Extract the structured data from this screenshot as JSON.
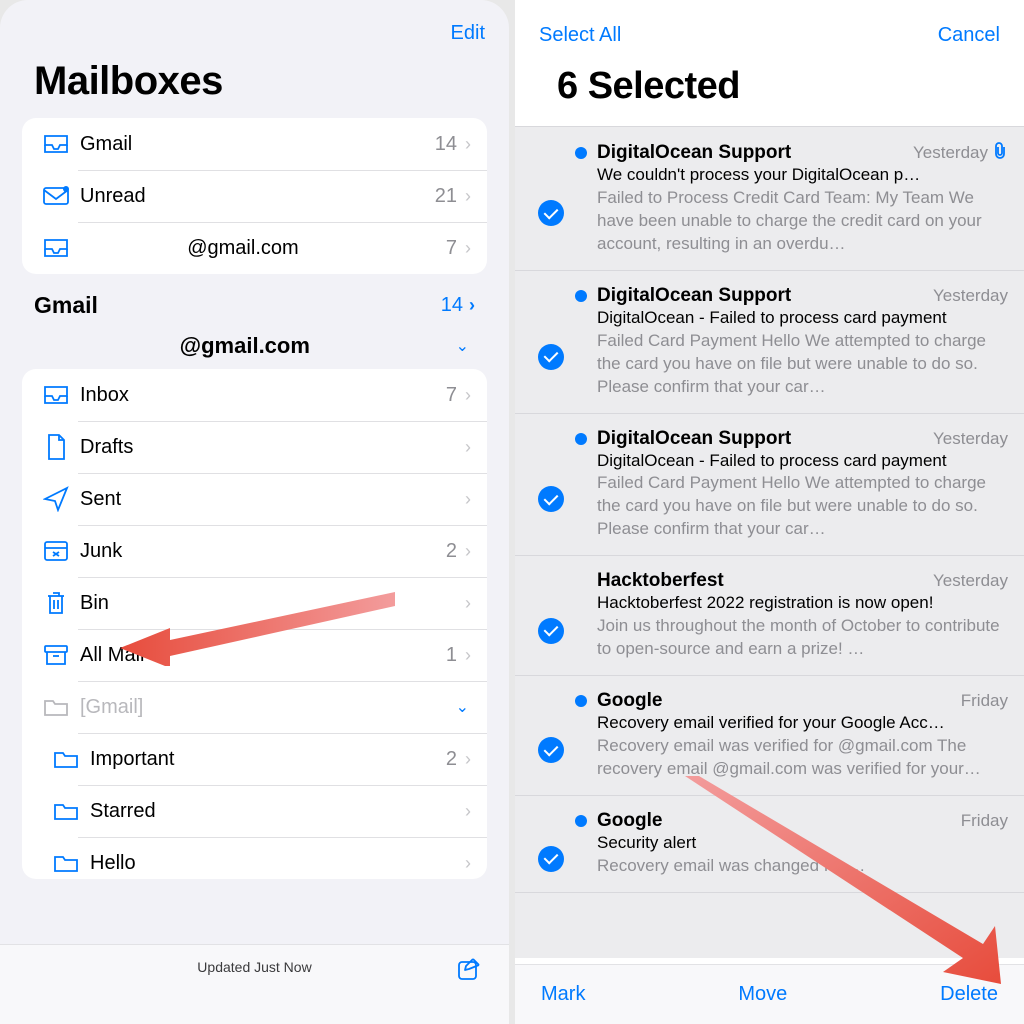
{
  "left": {
    "edit": "Edit",
    "title": "Mailboxes",
    "top_mailboxes": [
      {
        "icon": "inbox",
        "label": "Gmail",
        "count": "14",
        "disclosure": "chev"
      },
      {
        "icon": "unread",
        "label": "Unread",
        "count": "21",
        "disclosure": "chev"
      },
      {
        "icon": "inbox",
        "label": "@gmail.com",
        "count": "7",
        "disclosure": "chev",
        "center": true
      }
    ],
    "section": {
      "label": "Gmail",
      "count": "14"
    },
    "account_header": "@gmail.com",
    "folders": [
      {
        "icon": "inbox",
        "label": "Inbox",
        "count": "7",
        "disclosure": "chev"
      },
      {
        "icon": "drafts",
        "label": "Drafts",
        "count": "",
        "disclosure": "chev"
      },
      {
        "icon": "sent",
        "label": "Sent",
        "count": "",
        "disclosure": "chev"
      },
      {
        "icon": "junk",
        "label": "Junk",
        "count": "2",
        "disclosure": "chev"
      },
      {
        "icon": "bin",
        "label": "Bin",
        "count": "",
        "disclosure": "chev"
      },
      {
        "icon": "archive",
        "label": "All Mail",
        "count": "1",
        "disclosure": "chev"
      },
      {
        "icon": "folder",
        "label": "[Gmail]",
        "count": "",
        "disclosure": "caret",
        "disabled": true
      },
      {
        "icon": "folder",
        "label": "Important",
        "count": "2",
        "disclosure": "chev",
        "sub": true
      },
      {
        "icon": "folder",
        "label": "Starred",
        "count": "",
        "disclosure": "chev",
        "sub": true
      },
      {
        "icon": "folder",
        "label": "Hello",
        "count": "",
        "disclosure": "chev",
        "sub": true
      }
    ],
    "status": "Updated Just Now"
  },
  "right": {
    "select_all": "Select All",
    "cancel": "Cancel",
    "title": "6 Selected",
    "messages": [
      {
        "unread": true,
        "sender": "DigitalOcean Support",
        "when": "Yesterday",
        "attach": true,
        "subject": "We couldn't process your DigitalOcean p…",
        "preview": "Failed to Process Credit Card Team: My Team We have been unable to charge the credit card on your account, resulting in an overdu…"
      },
      {
        "unread": true,
        "sender": "DigitalOcean Support",
        "when": "Yesterday",
        "subject": "DigitalOcean - Failed to process card payment",
        "preview": "Failed Card Payment Hello We attempted to charge the card you have on file but were unable to do so. Please confirm that your car…"
      },
      {
        "unread": true,
        "sender": "DigitalOcean Support",
        "when": "Yesterday",
        "subject": "DigitalOcean - Failed to process card payment",
        "preview": "Failed Card Payment Hello We attempted to charge the card you have on file but were unable to do so. Please confirm that your car…"
      },
      {
        "unread": false,
        "sender": "Hacktoberfest",
        "when": "Yesterday",
        "subject": "Hacktoberfest 2022 registration is now open!",
        "preview": "Join us throughout the month of October to contribute to open-source and earn a prize!\n…"
      },
      {
        "unread": true,
        "sender": "Google",
        "when": "Friday",
        "subject": "Recovery email verified for your Google Acc…",
        "preview": "Recovery email was verified for             @gmail.com The recovery email             @gmail.com was verified for your…"
      },
      {
        "unread": true,
        "sender": "Google",
        "when": "Friday",
        "subject": "Security alert",
        "preview": "Recovery email was changed for …"
      }
    ],
    "footer": {
      "mark": "Mark",
      "move": "Move",
      "delete": "Delete"
    }
  },
  "colors": {
    "accent": "#007aff"
  }
}
